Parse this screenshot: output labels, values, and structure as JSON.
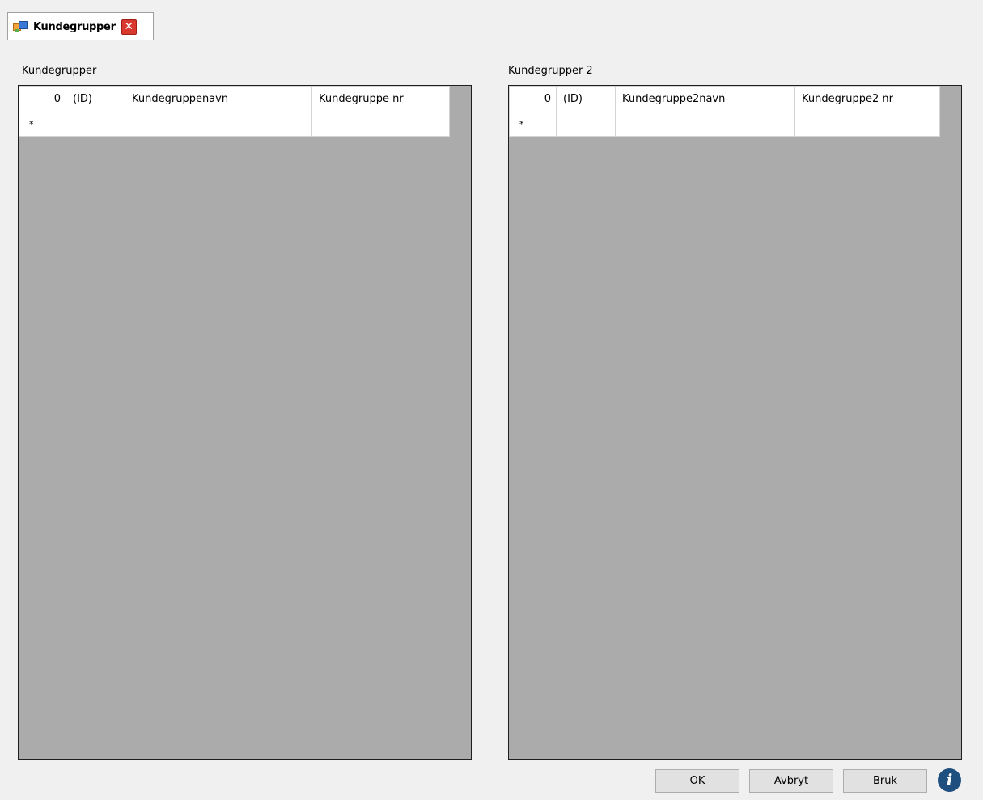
{
  "tab": {
    "title": "Kundegrupper",
    "close_symbol": "✕"
  },
  "left_grid": {
    "label": "Kundegrupper",
    "header": {
      "row_header": "0",
      "columns": [
        "(ID)",
        "Kundegruppenavn",
        "Kundegruppe nr"
      ]
    },
    "new_row_marker": "*"
  },
  "right_grid": {
    "label": "Kundegrupper 2",
    "header": {
      "row_header": "0",
      "columns": [
        "(ID)",
        "Kundegruppe2navn",
        "Kundegruppe2 nr"
      ]
    },
    "new_row_marker": "*"
  },
  "buttons": {
    "ok": "OK",
    "cancel": "Avbryt",
    "apply": "Bruk"
  },
  "info_symbol": "i",
  "colors": {
    "grid_background": "#ababab",
    "close_red": "#d9382f",
    "info_blue": "#1f4f7f"
  }
}
